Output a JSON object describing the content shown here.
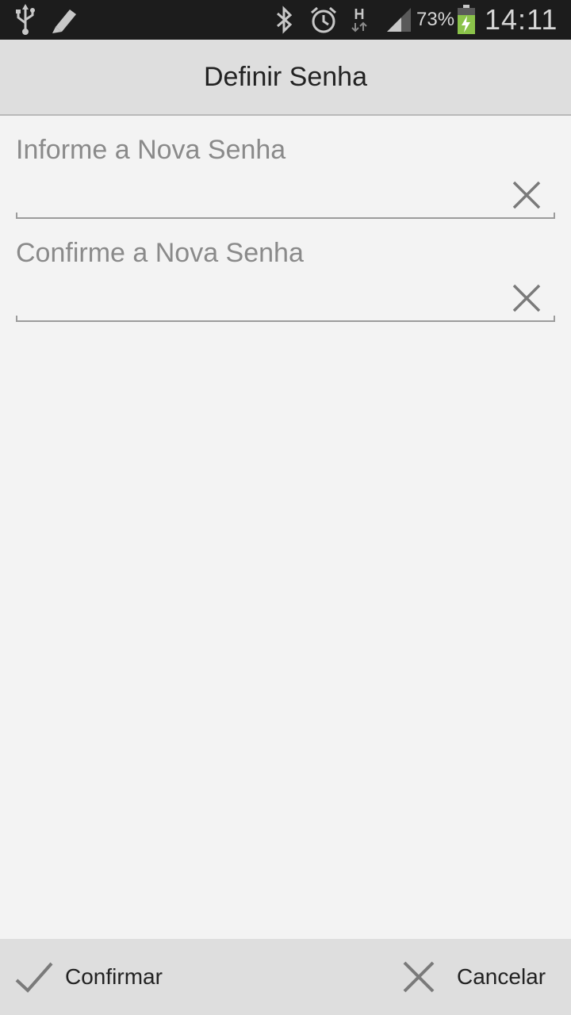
{
  "status_bar": {
    "battery_percent": "73%",
    "time": "14:11",
    "network_type": "H"
  },
  "title_bar": {
    "title": "Definir Senha"
  },
  "form": {
    "new_password": {
      "label": "Informe a Nova Senha",
      "value": ""
    },
    "confirm_password": {
      "label": "Confirme a Nova Senha",
      "value": ""
    }
  },
  "bottom_bar": {
    "confirm_label": "Confirmar",
    "cancel_label": "Cancelar"
  },
  "colors": {
    "background": "#f3f3f3",
    "bar": "#dedede",
    "status_bar": "#1c1c1c",
    "battery_green": "#8bc34a",
    "label_gray": "#8a8a8a"
  }
}
